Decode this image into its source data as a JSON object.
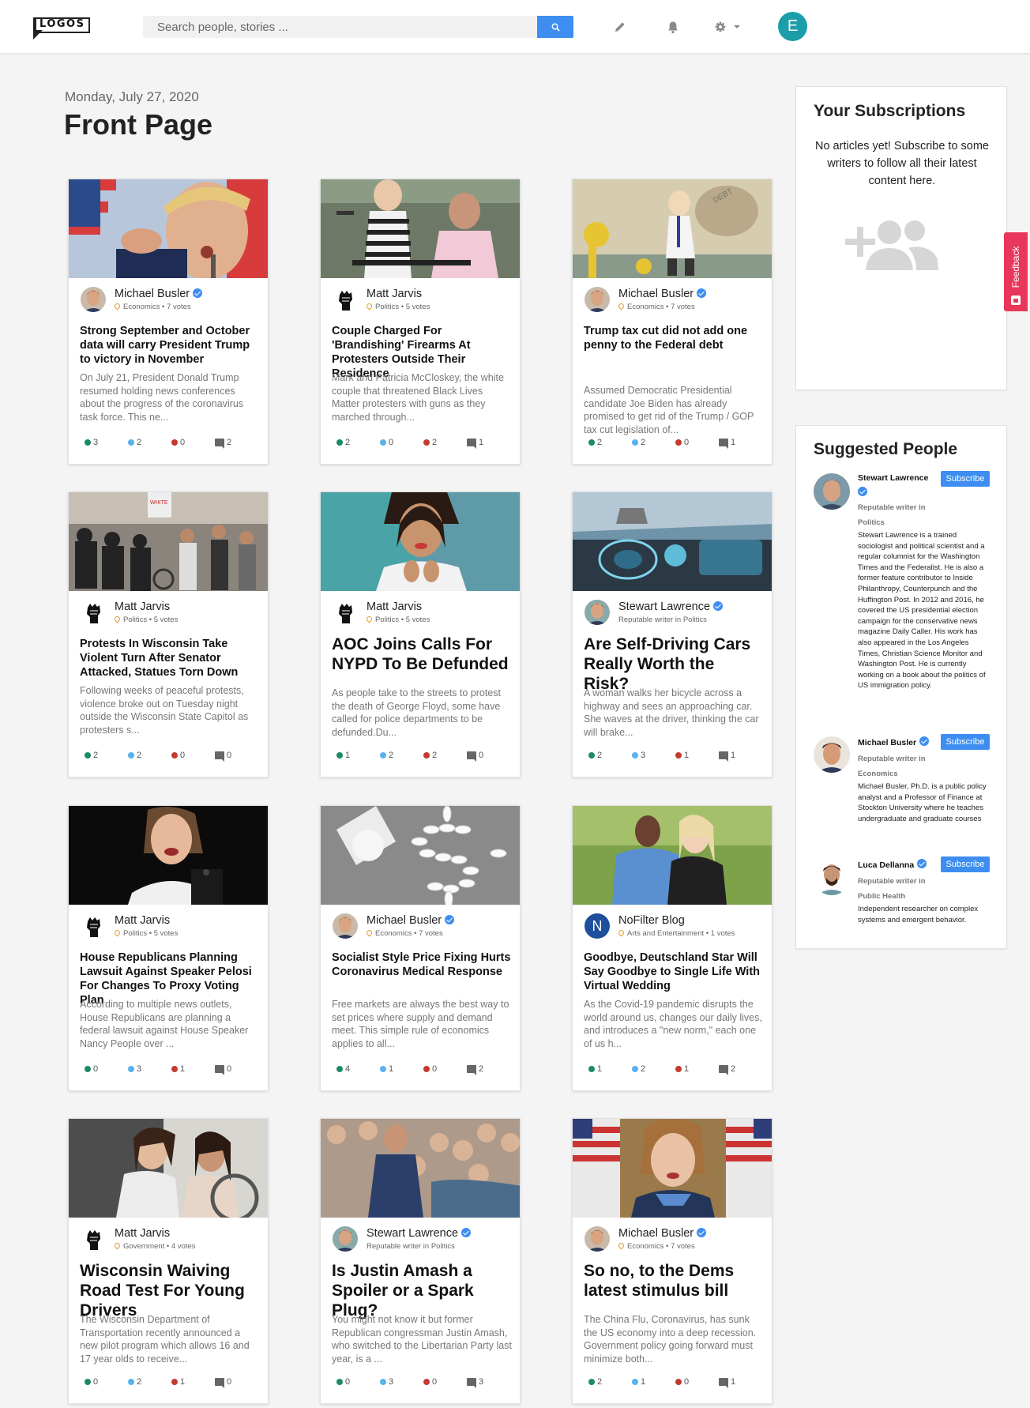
{
  "app": {
    "logo_text": "LOGOS"
  },
  "search": {
    "placeholder": "Search people, stories ..."
  },
  "header": {
    "date": "Monday, July 27, 2020",
    "title": "Front Page",
    "user_initial": "E"
  },
  "icons": {
    "edit": "pencil-icon",
    "notifications": "bell-icon",
    "settings": "gear-icon",
    "search": "search-icon"
  },
  "colors": {
    "accent": "#3d8ef0",
    "avatar": "#1b9ea9",
    "feedback": "#e8375a",
    "stat_green": "#1a8a6a",
    "stat_blue": "#58b2ee",
    "stat_red": "#c43a31"
  },
  "articles": [
    {
      "author": "Michael Busler",
      "verified": true,
      "topic": "Economics",
      "votes": "7 votes",
      "title": "Strong September and October data will carry President Trump to victory in November",
      "excerpt": "On July 21, President Donald Trump resumed holding news conferences about the progress of the coronavirus task force. This ne...",
      "s1": "3",
      "s2": "2",
      "s3": "0",
      "comments": "2"
    },
    {
      "author": "Matt Jarvis",
      "verified": false,
      "topic": "Politics",
      "votes": "5 votes",
      "title": "Couple Charged For 'Brandishing' Firearms At Protesters Outside Their Residence",
      "excerpt": "Mark and Patricia McCloskey, the white couple that threatened Black Lives Matter protesters with guns as they marched through...",
      "s1": "2",
      "s2": "0",
      "s3": "2",
      "comments": "1"
    },
    {
      "author": "Michael Busler",
      "verified": true,
      "topic": "Economics",
      "votes": "7 votes",
      "title": "Trump tax cut did not add one penny to the Federal debt",
      "excerpt": "Assumed Democratic Presidential candidate Joe Biden has already promised to get rid of the Trump / GOP tax cut legislation of...",
      "s1": "2",
      "s2": "2",
      "s3": "0",
      "comments": "1"
    },
    {
      "author": "Matt Jarvis",
      "verified": false,
      "topic": "Politics",
      "votes": "5 votes",
      "title": "Protests In Wisconsin Take Violent Turn After Senator Attacked, Statues Torn Down",
      "excerpt": "Following weeks of peaceful protests, violence broke out on Tuesday night outside the Wisconsin State Capitol as protesters s...",
      "s1": "2",
      "s2": "2",
      "s3": "0",
      "comments": "0"
    },
    {
      "author": "Matt Jarvis",
      "verified": false,
      "topic": "Politics",
      "votes": "5 votes",
      "title": "AOC Joins Calls For NYPD To Be Defunded",
      "excerpt": "As people take to the streets to protest the death of George Floyd, some have called for police departments to be defunded.Du...",
      "s1": "1",
      "s2": "2",
      "s3": "2",
      "comments": "0"
    },
    {
      "author": "Stewart Lawrence",
      "verified": true,
      "topic": "Reputable writer in Politics",
      "votes": "",
      "title": "Are Self-Driving Cars Really Worth the Risk?",
      "excerpt": "A woman walks her bicycle across a highway and sees an approaching car. She waves at the driver, thinking the car will brake...",
      "s1": "2",
      "s2": "3",
      "s3": "1",
      "comments": "1"
    },
    {
      "author": "Matt Jarvis",
      "verified": false,
      "topic": "Politics",
      "votes": "5 votes",
      "title": "House Republicans Planning Lawsuit Against Speaker Pelosi For Changes To Proxy Voting Plan",
      "excerpt": "According to multiple news outlets, House Republicans are planning a federal lawsuit against House Speaker Nancy People over ...",
      "s1": "0",
      "s2": "3",
      "s3": "1",
      "comments": "0"
    },
    {
      "author": "Michael Busler",
      "verified": true,
      "topic": "Economics",
      "votes": "7 votes",
      "title": "Socialist Style Price Fixing Hurts Coronavirus Medical Response",
      "excerpt": "Free markets are always the best way to set prices where supply and demand meet. This simple rule of economics applies to all...",
      "s1": "4",
      "s2": "1",
      "s3": "0",
      "comments": "2"
    },
    {
      "author": "NoFilter Blog",
      "verified": false,
      "topic": "Arts and Entertainment",
      "votes": "1 votes",
      "title": "Goodbye, Deutschland Star Will Say Goodbye to Single Life With Virtual Wedding",
      "excerpt": "As the Covid-19 pandemic disrupts the world around us, changes our daily lives, and introduces a \"new norm,\" each one of us h...",
      "s1": "1",
      "s2": "2",
      "s3": "1",
      "comments": "2"
    },
    {
      "author": "Matt Jarvis",
      "verified": false,
      "topic": "Government",
      "votes": "4 votes",
      "title": "Wisconsin Waiving Road Test For Young Drivers",
      "excerpt": "The Wisconsin Department of Transportation recently announced a new pilot program which allows 16 and 17 year olds to receive...",
      "s1": "0",
      "s2": "2",
      "s3": "1",
      "comments": "0"
    },
    {
      "author": "Stewart Lawrence",
      "verified": true,
      "topic": "Reputable writer in Politics",
      "votes": "",
      "title": "Is Justin Amash a Spoiler or a Spark Plug?",
      "excerpt": "You might not know it but former Republican congressman Justin Amash, who switched to the Libertarian Party last year, is a ...",
      "s1": "0",
      "s2": "3",
      "s3": "0",
      "comments": "3"
    },
    {
      "author": "Michael Busler",
      "verified": true,
      "topic": "Economics",
      "votes": "7 votes",
      "title": "So no, to the Dems latest stimulus bill",
      "excerpt": "The China Flu, Coronavirus, has sunk the US economy into a deep recession. Government policy going forward must minimize both...",
      "s1": "2",
      "s2": "1",
      "s3": "0",
      "comments": "1"
    }
  ],
  "subscriptions": {
    "title": "Your Subscriptions",
    "message": "No articles yet! Subscribe to some writers to follow all their latest content here."
  },
  "suggested": {
    "title": "Suggested People",
    "subscribe_label": "Subscribe",
    "people": [
      {
        "name": "Stewart Lawrence",
        "rep": "Reputable writer in",
        "topic": "Politics",
        "bio": "Stewart Lawrence is a trained sociologist and political scientist and a regular columnist for the Washington Times and the Federalist. He is also a former feature contributor to Inside Philanthropy, Counterpunch and the Huffington Post. In 2012 and 2016, he covered the US presidential election campaign for the conservative news magazine Daily Caller. His work has also appeared in the Los Angeles Times, Christian Science Monitor and Washington Post. He is currently working on a book about the politics of US immigration policy."
      },
      {
        "name": "Michael Busler",
        "rep": "Reputable writer in",
        "topic": "Economics",
        "bio": "Michael Busler, Ph.D. is a public policy analyst and a Professor of Finance at Stockton University where he teaches undergraduate and graduate courses"
      },
      {
        "name": "Luca Dellanna",
        "rep": "Reputable writer in",
        "topic": "Public Health",
        "bio": "Independent researcher on complex systems and emergent behavior."
      }
    ]
  },
  "feedback": {
    "label": "Feedback"
  }
}
